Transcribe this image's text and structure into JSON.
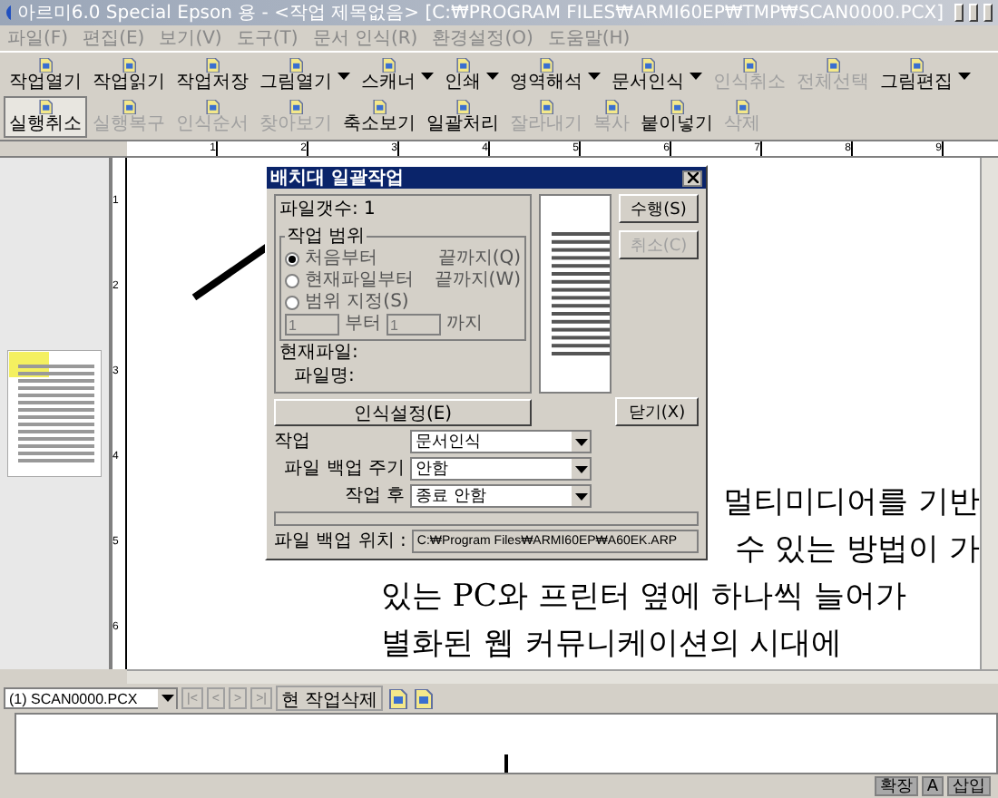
{
  "window": {
    "title": "아르미6.0 Special Epson 용 - <작업 제목없음> [C:₩PROGRAM FILES₩ARMI60EP₩TMP₩SCAN0000.PCX]"
  },
  "menu": [
    "파일(F)",
    "편집(E)",
    "보기(V)",
    "도구(T)",
    "문서 인식(R)",
    "환경설정(O)",
    "도움말(H)"
  ],
  "toolbar": [
    {
      "label": "작업열기",
      "disabled": false,
      "dropdown": false,
      "pressed": false
    },
    {
      "label": "작업읽기",
      "disabled": false,
      "dropdown": false,
      "pressed": false
    },
    {
      "label": "작업저장",
      "disabled": false,
      "dropdown": false,
      "pressed": false
    },
    {
      "label": "그림열기",
      "disabled": false,
      "dropdown": true,
      "pressed": false
    },
    {
      "label": "스캐너",
      "disabled": false,
      "dropdown": true,
      "pressed": false
    },
    {
      "label": "인쇄",
      "disabled": false,
      "dropdown": true,
      "pressed": false
    },
    {
      "label": "영역해석",
      "disabled": false,
      "dropdown": true,
      "pressed": false
    },
    {
      "label": "문서인식",
      "disabled": false,
      "dropdown": true,
      "pressed": false
    },
    {
      "label": "인식취소",
      "disabled": true,
      "dropdown": false,
      "pressed": false
    },
    {
      "label": "전체선택",
      "disabled": true,
      "dropdown": false,
      "pressed": false
    },
    {
      "label": "그림편집",
      "disabled": false,
      "dropdown": true,
      "pressed": false
    },
    {
      "label": "실행취소",
      "disabled": false,
      "dropdown": false,
      "pressed": true
    },
    {
      "label": "실행복구",
      "disabled": true,
      "dropdown": false,
      "pressed": false
    },
    {
      "label": "인식순서",
      "disabled": true,
      "dropdown": false,
      "pressed": false
    },
    {
      "label": "찾아보기",
      "disabled": true,
      "dropdown": false,
      "pressed": false
    },
    {
      "label": "축소보기",
      "disabled": false,
      "dropdown": false,
      "pressed": false
    },
    {
      "label": "일괄처리",
      "disabled": false,
      "dropdown": false,
      "pressed": false
    },
    {
      "label": "잘라내기",
      "disabled": true,
      "dropdown": false,
      "pressed": false
    },
    {
      "label": "복사",
      "disabled": true,
      "dropdown": false,
      "pressed": false
    },
    {
      "label": "붙이넣기",
      "disabled": false,
      "dropdown": false,
      "pressed": false
    },
    {
      "label": "삭제",
      "disabled": true,
      "dropdown": false,
      "pressed": false
    }
  ],
  "ruler": {
    "h_ticks": [
      "1",
      "2",
      "3",
      "4",
      "5",
      "6",
      "7",
      "8",
      "9"
    ],
    "v_ticks": [
      "1",
      "2",
      "3",
      "4",
      "5",
      "6"
    ]
  },
  "document": {
    "lines": [
      {
        "text": "멀티미디어를 기반",
        "kind": "partial"
      },
      {
        "text": "수  있는 방법이 가",
        "kind": "partial"
      },
      {
        "text": "있는 PC와 프린터 옆에 하나씩 늘어가",
        "kind": "full"
      },
      {
        "text": "별화된  웹 커뮤니케이션의 시대에",
        "kind": "full"
      }
    ]
  },
  "dialog": {
    "title": "배치대 일괄작업",
    "file_count": "파일갯수:  1",
    "range": {
      "legend": "작업 범위",
      "options": [
        {
          "label": "처음부터",
          "selected": true,
          "suffix": "끝까지(Q)"
        },
        {
          "label": "현재파일부터",
          "selected": false,
          "suffix": "끝까지(W)"
        },
        {
          "label": "범위 지정(S)",
          "selected": false
        }
      ],
      "from_value": "1",
      "from_label": "부터",
      "to_value": "1",
      "to_label": "까지"
    },
    "current_file": "현재파일:",
    "file_name": "파일명:",
    "settings_button": "인식설정(E)",
    "selects": [
      {
        "label": "작업",
        "value": "문서인식"
      },
      {
        "label": "파일 백업 주기",
        "value": "안함"
      },
      {
        "label": "작업 후",
        "value": "종료 안함"
      }
    ],
    "progress": {
      "level": 0
    },
    "backup_label": "파일 백업 위치 :",
    "backup_path": "C:₩Program Files₩ARMI60EP₩A60EK.ARP",
    "buttons": [
      {
        "label": "수행(S)",
        "disabled": false
      },
      {
        "label": "취소(C)",
        "disabled": true
      },
      {
        "label": "닫기(X)",
        "disabled": false
      }
    ]
  },
  "bottom_toolbar": {
    "file_select": "(1) SCAN0000.PCX",
    "nav": [
      "|<",
      "<",
      ">",
      ">|"
    ],
    "delete_button": "현 작업삭제"
  },
  "status_bar": [
    "확장",
    "A",
    "삽입"
  ]
}
